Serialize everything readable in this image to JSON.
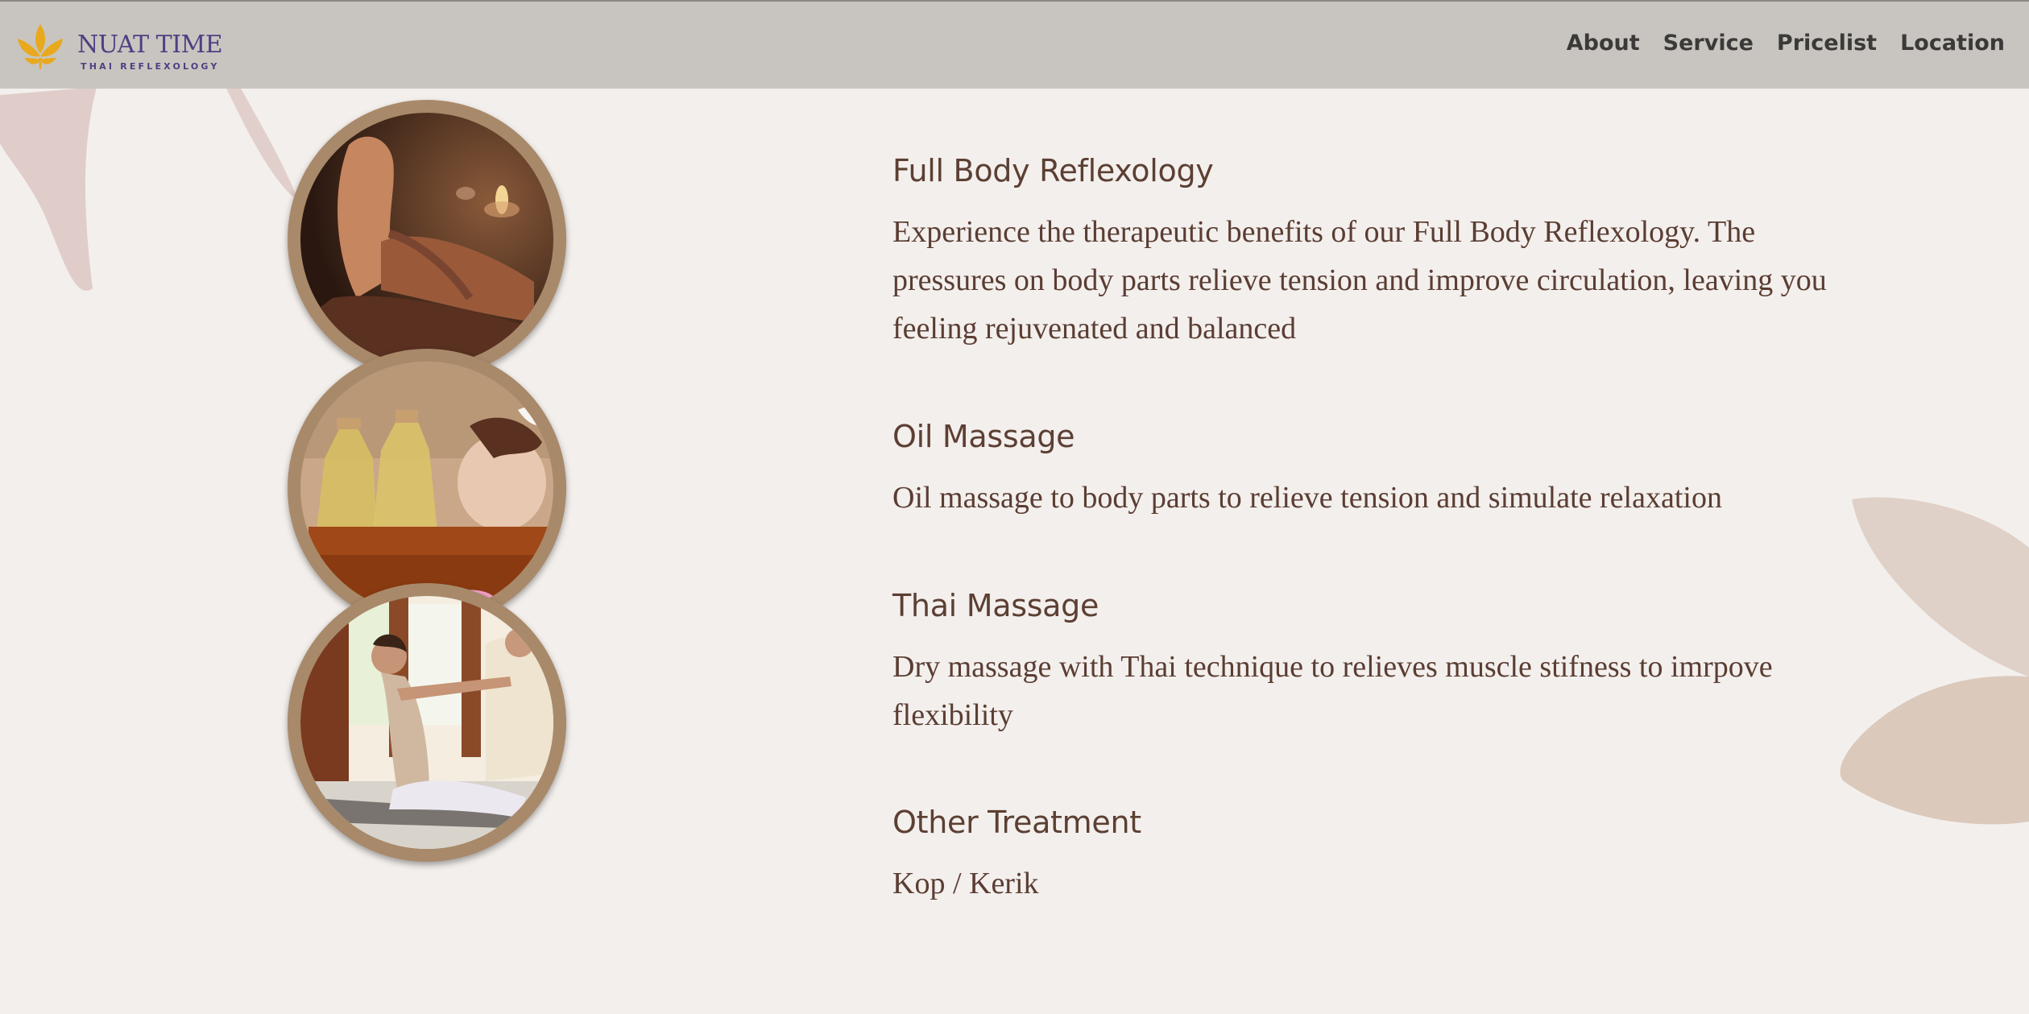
{
  "brand": {
    "name": "NUAT TIME",
    "tagline": "THAI REFLEXOLOGY"
  },
  "nav": {
    "items": [
      "About",
      "Service",
      "Pricelist",
      "Location"
    ]
  },
  "services": [
    {
      "title": "Full Body Reflexology",
      "description": "Experience the therapeutic benefits of our Full Body Reflexology. The pressures on body parts relieve tension and improve circulation, leaving you feeling rejuvenated and balanced"
    },
    {
      "title": "Oil Massage",
      "description": "Oil massage to body parts to relieve tension and simulate relaxation"
    },
    {
      "title": "Thai Massage",
      "description": "Dry massage with Thai technique to relieves muscle stifness to imrpove flexibility"
    },
    {
      "title": "Other Treatment",
      "description": "Kop / Kerik"
    }
  ],
  "colors": {
    "header_bg": "#c8c5c0",
    "page_bg": "#f3efec",
    "heading": "#5c3f33",
    "body_text": "#5a3d33",
    "brand_purple": "#4e3f83",
    "brand_gold": "#e8a91f",
    "circle_frame": "#a8896a"
  },
  "images": [
    {
      "icon": "foot-reflexology-photo"
    },
    {
      "icon": "oil-massage-photo"
    },
    {
      "icon": "thai-massage-photo"
    }
  ]
}
